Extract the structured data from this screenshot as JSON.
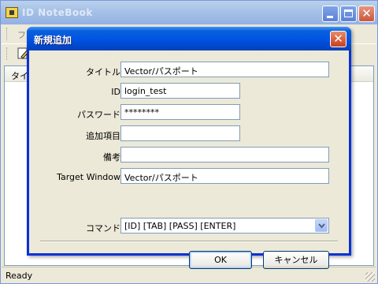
{
  "main_window": {
    "title": "ID NoteBook",
    "menu_first": "ファ",
    "list_column": "タイト",
    "status": "Ready",
    "caption_buttons": {
      "minimize": "_",
      "maximize": "□",
      "close": "✕"
    }
  },
  "dialog": {
    "title": "新規追加",
    "close_glyph": "✕",
    "fields": {
      "title_label": "タイトル",
      "title_value": "Vector/パスポート",
      "id_label": "ID",
      "id_value": "login_test",
      "password_label": "パスワード",
      "password_value": "********",
      "extra_label": "追加項目",
      "extra_value": "",
      "note_label": "備考",
      "note_value": "",
      "target_label": "Target Window",
      "target_value": "Vector/パスポート",
      "command_label": "コマンド",
      "command_value": "[ID] [TAB] [PASS] [ENTER]"
    },
    "ok_label": "OK",
    "cancel_label": "キャンセル"
  },
  "colors": {
    "dialog_title_blue": "#0055e5",
    "inactive_title": "#a6c1e8",
    "close_red": "#c8401d",
    "face": "#ece9d8"
  }
}
